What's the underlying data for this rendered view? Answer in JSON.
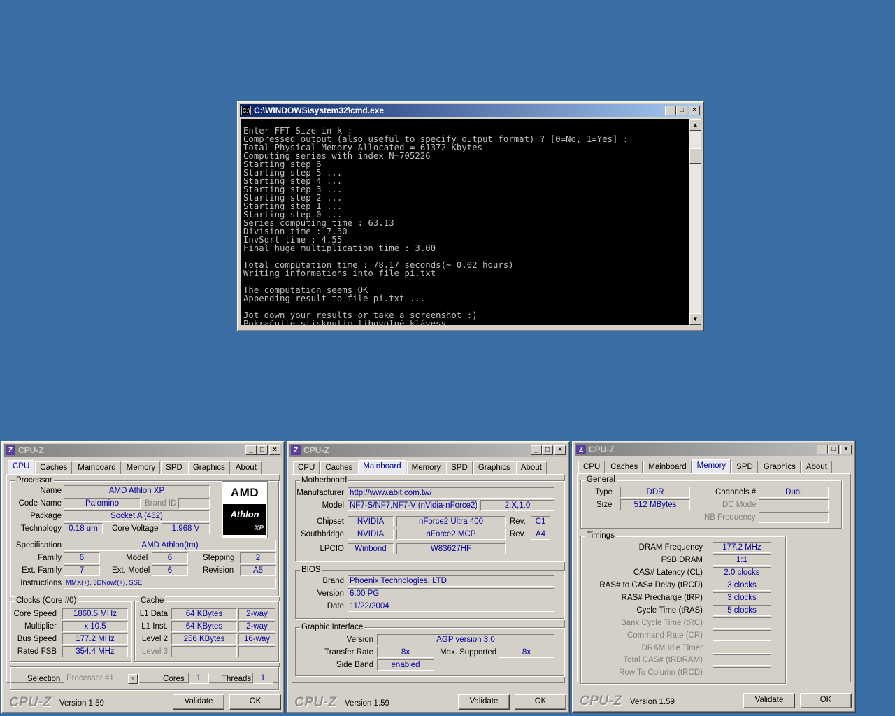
{
  "cmd": {
    "title": "C:\\WINDOWS\\system32\\cmd.exe",
    "icon": "cmd-icon",
    "lines": [
      "Enter FFT Size in k :",
      "Compressed output (also useful to specify output format) ? [0=No, 1=Yes] :",
      "Total Physical Memory Allocated = 61372 Kbytes",
      "Computing series with index N=705226",
      "Starting step 6",
      "Starting step 5 ...",
      "Starting step 4 ...",
      "Starting step 3 ...",
      "Starting step 2 ...",
      "Starting step 1 ...",
      "Starting step 0 ...",
      "Series computing time : 63.13",
      "Division time : 7.30",
      "InvSqrt time : 4.55",
      "Final huge multiplication time : 3.00",
      "-------------------------------------------------------------",
      "Total computation time : 78.17 seconds(~ 0.02 hours)",
      "Writing informations into file pi.txt",
      "",
      "The computation seems OK",
      "Appending result to file pi.txt ...",
      "",
      "Jot down your results or take a screenshot :)",
      "Pokračujte stisknutím libovolné klávesy..."
    ]
  },
  "cpuz_common": {
    "title": "CPU-Z",
    "tabs": [
      "CPU",
      "Caches",
      "Mainboard",
      "Memory",
      "SPD",
      "Graphics",
      "About"
    ],
    "logo": "CPU-Z",
    "version": "Version 1.59",
    "validate": "Validate",
    "ok": "OK"
  },
  "cpu": {
    "processor_group": "Processor",
    "name_label": "Name",
    "name": "AMD Athlon XP",
    "codename_label": "Code Name",
    "codename": "Palomino",
    "brandid_label": "Brand ID",
    "brandid": "",
    "package_label": "Package",
    "package": "Socket A (462)",
    "technology_label": "Technology",
    "technology": "0.18 um",
    "corevoltage_label": "Core Voltage",
    "corevoltage": "1.968 V",
    "spec_label": "Specification",
    "spec": "AMD Athlon(tm)",
    "family_label": "Family",
    "family": "6",
    "model_label": "Model",
    "model": "6",
    "stepping_label": "Stepping",
    "stepping": "2",
    "extfamily_label": "Ext. Family",
    "extfamily": "7",
    "extmodel_label": "Ext. Model",
    "extmodel": "6",
    "revision_label": "Revision",
    "revision": "A5",
    "instr_label": "Instructions",
    "instr": "MMX(+), 3DNow!(+), SSE",
    "logo_amd": "AMD",
    "logo_athlon": "Athlon",
    "logo_xp": "XP",
    "clocks_group": "Clocks (Core #0)",
    "corespeed_label": "Core Speed",
    "corespeed": "1860.5 MHz",
    "multiplier_label": "Multiplier",
    "multiplier": "x 10.5",
    "busspeed_label": "Bus Speed",
    "busspeed": "177.2 MHz",
    "ratedfsb_label": "Rated FSB",
    "ratedfsb": "354.4 MHz",
    "cache_group": "Cache",
    "l1data_label": "L1 Data",
    "l1data": "64 KBytes",
    "l1data_way": "2-way",
    "l1inst_label": "L1 Inst.",
    "l1inst": "64 KBytes",
    "l1inst_way": "2-way",
    "level2_label": "Level 2",
    "level2": "256 KBytes",
    "level2_way": "16-way",
    "level3_label": "Level 3",
    "level3": "",
    "level3_way": "",
    "selection_label": "Selection",
    "selection": "Processor #1",
    "cores_label": "Cores",
    "cores": "1",
    "threads_label": "Threads",
    "threads": "1"
  },
  "mainboard": {
    "mb_group": "Motherboard",
    "manufacturer_label": "Manufacturer",
    "manufacturer": "http://www.abit.com.tw/",
    "model_label": "Model",
    "model": "NF7-S/NF7,NF7-V (nVidia-nForce2)",
    "model_rev": "2.X,1.0",
    "chipset_label": "Chipset",
    "chipset_vendor": "NVIDIA",
    "chipset": "nForce2 Ultra 400",
    "rev_label": "Rev.",
    "chipset_rev": "C1",
    "southbridge_label": "Southbridge",
    "sb_vendor": "NVIDIA",
    "sb": "nForce2 MCP",
    "sb_rev": "A4",
    "lpcio_label": "LPCIO",
    "lpcio_vendor": "Winbond",
    "lpcio": "W83627HF",
    "bios_group": "BIOS",
    "brand_label": "Brand",
    "brand": "Phoenix Technologies, LTD",
    "version_label": "Version",
    "version": "6.00 PG",
    "date_label": "Date",
    "date": "11/22/2004",
    "gi_group": "Graphic Interface",
    "giversion_label": "Version",
    "giversion": "AGP version 3.0",
    "transfer_label": "Transfer Rate",
    "transfer": "8x",
    "maxsup_label": "Max. Supported",
    "maxsup": "8x",
    "sideband_label": "Side Band",
    "sideband": "enabled"
  },
  "memory": {
    "general_group": "General",
    "type_label": "Type",
    "type": "DDR",
    "channels_label": "Channels #",
    "channels": "Dual",
    "size_label": "Size",
    "size": "512 MBytes",
    "dcmode_label": "DC Mode",
    "dcmode": "",
    "nbfreq_label": "NB Frequency",
    "nbfreq": "",
    "timings_group": "Timings",
    "dramfreq_label": "DRAM Frequency",
    "dramfreq": "177.2 MHz",
    "fsbdram_label": "FSB:DRAM",
    "fsbdram": "1:1",
    "cas_label": "CAS# Latency (CL)",
    "cas": "2.0 clocks",
    "rcd_label": "RAS# to CAS# Delay (tRCD)",
    "rcd": "3 clocks",
    "rp_label": "RAS# Precharge (tRP)",
    "rp": "3 clocks",
    "ras_label": "Cycle Time (tRAS)",
    "ras": "5 clocks",
    "rc_label": "Bank Cycle Time (tRC)",
    "cr_label": "Command Rate (CR)",
    "idle_label": "DRAM Idle Timer",
    "rdram_label": "Total CAS# (tRDRAM)",
    "rtc_label": "Row To Column (tRCD)"
  }
}
